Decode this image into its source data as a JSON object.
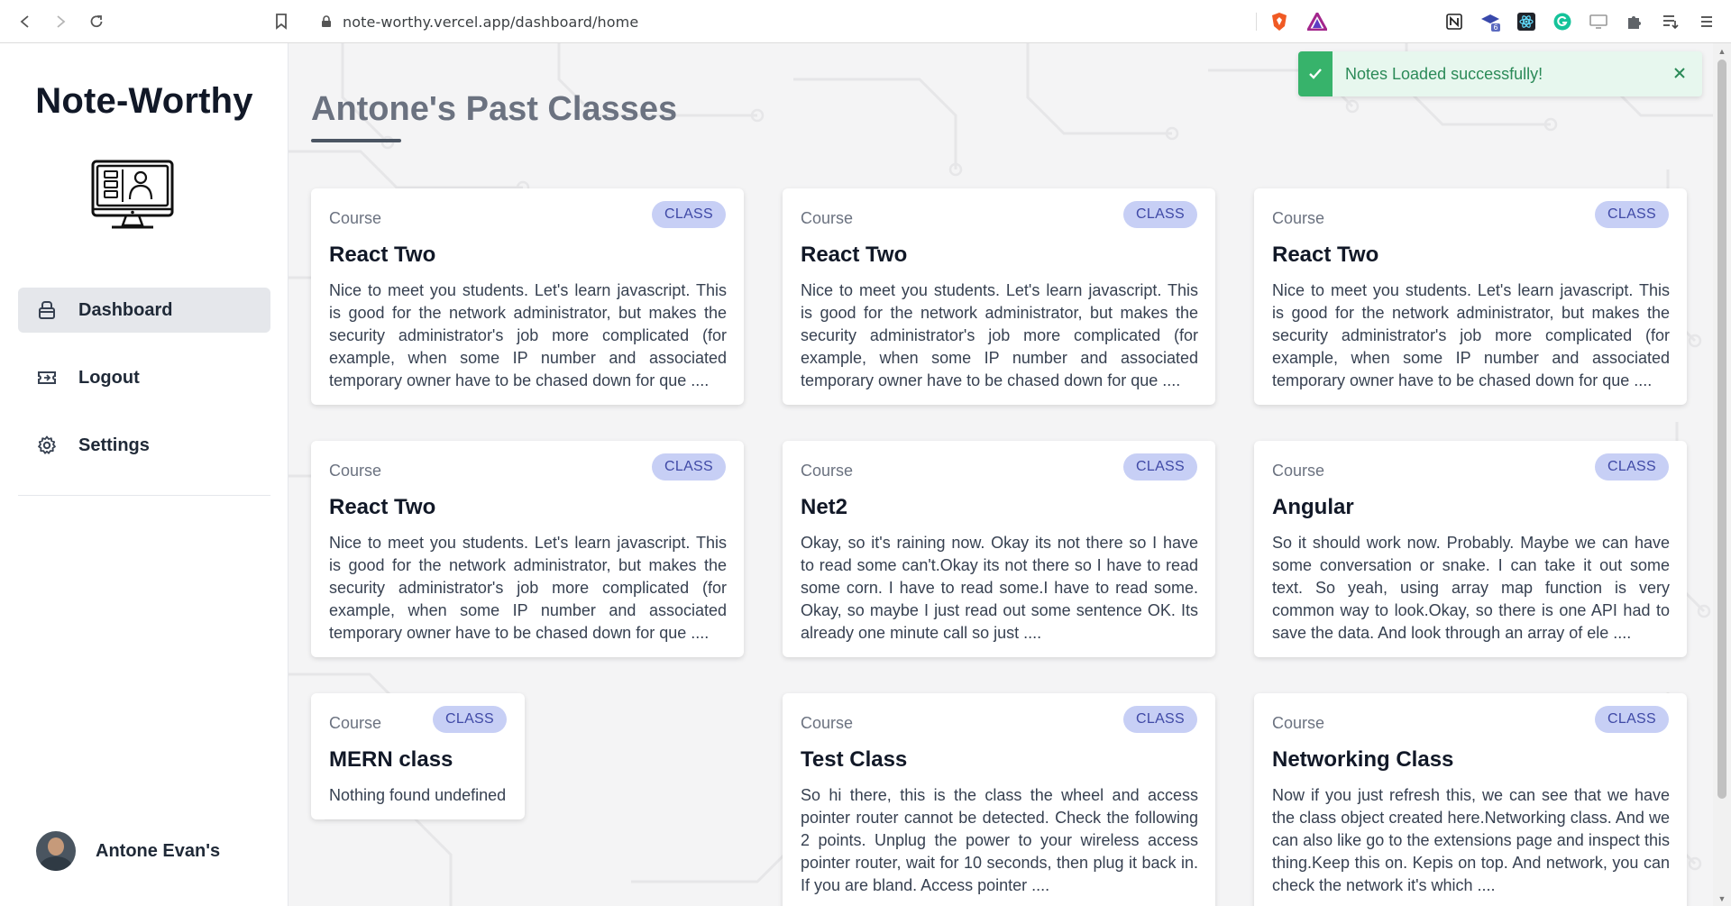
{
  "browser": {
    "url": "note-worthy.vercel.app/dashboard/home"
  },
  "sidebar": {
    "brand": "Note-Worthy",
    "items": [
      {
        "label": "Dashboard",
        "icon": "bag-icon",
        "active": true
      },
      {
        "label": "Logout",
        "icon": "ticket-icon",
        "active": false
      },
      {
        "label": "Settings",
        "icon": "gear-icon",
        "active": false
      }
    ],
    "profile": {
      "name": "Antone Evan's"
    }
  },
  "main": {
    "title": "Antone's Past Classes",
    "cards": [
      {
        "course": "Course",
        "badge": "CLASS",
        "title": "React Two",
        "desc": "Nice to meet you students. Let's learn javascript. This is good for the network administrator, but makes the security administrator's job more complicated (for example, when some IP number and associated temporary owner have to be chased down for que ...."
      },
      {
        "course": "Course",
        "badge": "CLASS",
        "title": "React Two",
        "desc": "Nice to meet you students. Let's learn javascript. This is good for the network administrator, but makes the security administrator's job more complicated (for example, when some IP number and associated temporary owner have to be chased down for que ...."
      },
      {
        "course": "Course",
        "badge": "CLASS",
        "title": "React Two",
        "desc": "Nice to meet you students. Let's learn javascript. This is good for the network administrator, but makes the security administrator's job more complicated (for example, when some IP number and associated temporary owner have to be chased down for que ...."
      },
      {
        "course": "Course",
        "badge": "CLASS",
        "title": "React Two",
        "desc": "Nice to meet you students. Let's learn javascript. This is good for the network administrator, but makes the security administrator's job more complicated (for example, when some IP number and associated temporary owner have to be chased down for que ...."
      },
      {
        "course": "Course",
        "badge": "CLASS",
        "title": "Net2",
        "desc": "Okay, so it's raining now. Okay its not there so I have to read some can't.Okay its not there so I have to read some corn. I have to read some.I have to read some. Okay, so maybe I just read out some sentence OK. Its already one minute call so just ...."
      },
      {
        "course": "Course",
        "badge": "CLASS",
        "title": "Angular",
        "desc": "So it should work now. Probably. Maybe we can have some conversation or snake. I can take it out some text. So yeah, using array map function is very common way to look.Okay, so there is one API had to save the data. And look through an array of ele ...."
      },
      {
        "course": "Course",
        "badge": "CLASS",
        "title": "MERN class",
        "desc": "Nothing found undefined"
      },
      {
        "course": "Course",
        "badge": "CLASS",
        "title": "Test Class",
        "desc": "So hi there, this is the class the wheel and access pointer router cannot be detected. Check the following 2 points. Unplug the power to your wireless access pointer router, wait for 10 seconds, then plug it back in. If you are bland. Access pointer ...."
      },
      {
        "course": "Course",
        "badge": "CLASS",
        "title": "Networking Class",
        "desc": "Now if you just refresh this, we can see that we have the class object created here.Networking class. And we can also like go to the extensions page and inspect this thing.Keep this on. Kepis on top. And network, you can check the network it's which ...."
      }
    ]
  },
  "toast": {
    "message": "Notes Loaded successfully!"
  },
  "colors": {
    "badge_bg": "#c7cff5",
    "badge_text": "#3f49a6",
    "toast_bg": "#e7f7ee",
    "toast_accent": "#37b36b"
  }
}
